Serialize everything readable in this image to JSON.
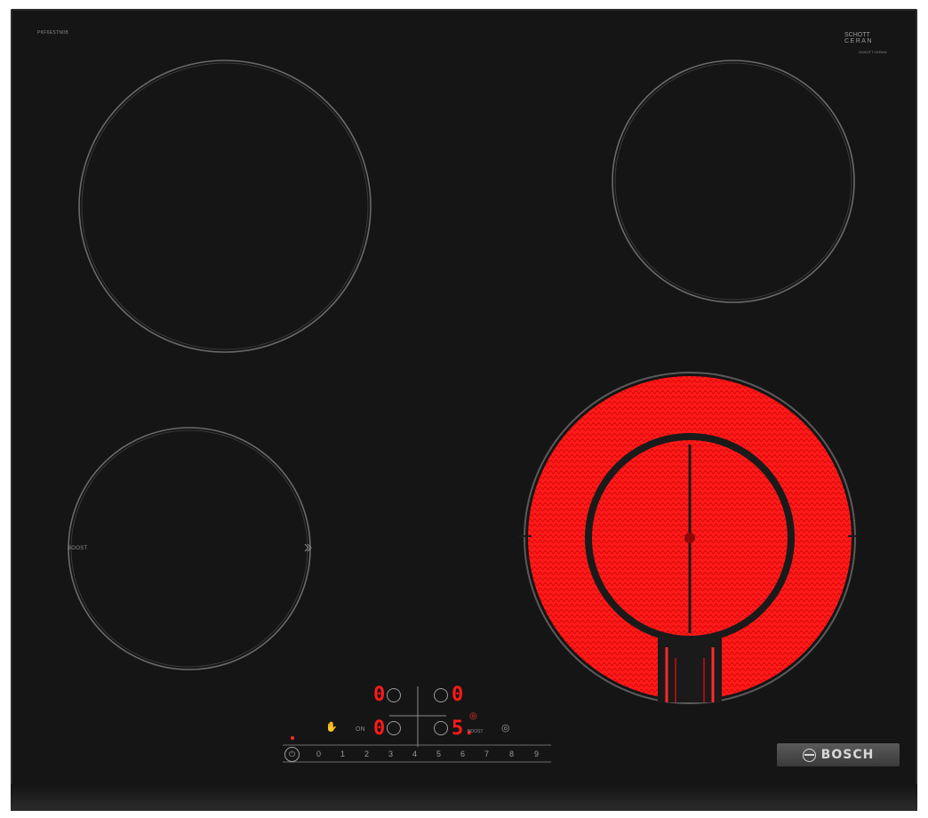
{
  "cooktop": {
    "model_code": "PKF6ESTN0B",
    "glass_brand_line1": "SCHOTT",
    "glass_brand_line2": "CERAN",
    "glass_brand_sub": "SCHOTT CERAN",
    "boost_label": "BOOST",
    "brand": "BOSCH",
    "colors": {
      "glass": "#151515",
      "heating": "#ff1a1a",
      "markings": "#8a8a8a"
    }
  },
  "controls": {
    "top_left_level": "0",
    "top_right_level": "0",
    "bottom_left_level": "0",
    "bottom_right_level": "5.",
    "boost_button_label": "BOOST",
    "on_label": "ON",
    "slider_values": [
      "0",
      "1",
      "2",
      "3",
      "4",
      "5",
      "6",
      "7",
      "8",
      "9"
    ],
    "power_icon": "power-icon",
    "childlock_icon": "hand-icon",
    "timer_icon": "timer-icon"
  }
}
